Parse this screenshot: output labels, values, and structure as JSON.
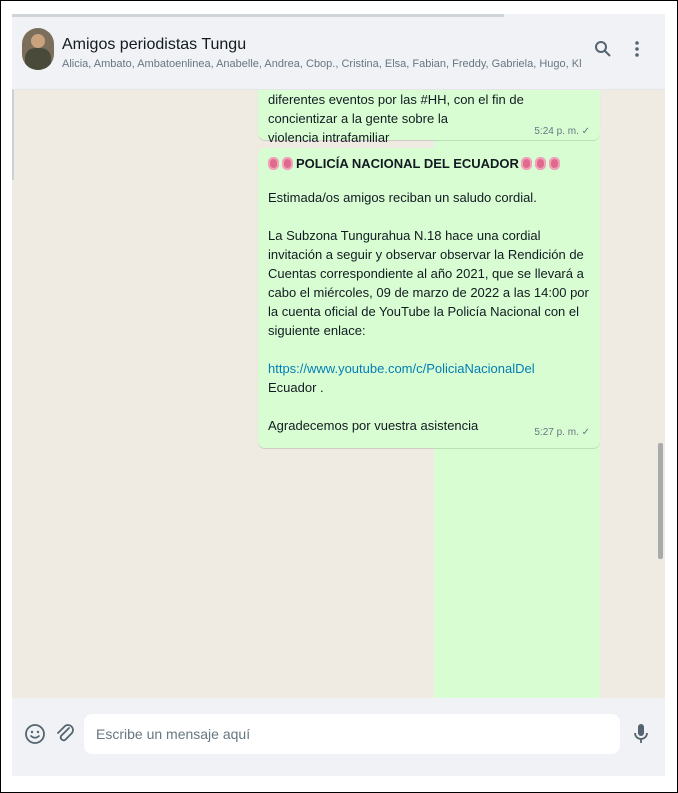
{
  "header": {
    "title": "Amigos periodistas Tungu",
    "members": "Alicia, Ambato, Ambatoenlinea, Anabelle, Andrea, Cbop., Cristina, Elsa, Fabian, Freddy, Gabriela, Hugo, Klever, Maria, Modesto, M...",
    "search_icon": "search-icon",
    "menu_icon": "more-vertical-icon"
  },
  "messages": [
    {
      "line1": "diferentes eventos por las #HH, con el fin de concientizar a la gente sobre la",
      "line2": "violencia intrafamiliar",
      "time": "5:24 p. m. ✓"
    },
    {
      "heading": "POLICÍA NACIONAL DEL ECUADOR",
      "greeting": "Estimada/os amigos reciban un saludo cordial.",
      "body": "La Subzona Tungurahua N.18 hace una cordial invitación a seguir y observar observar la Rendición de Cuentas correspondiente al año 2021, que se llevará a cabo el miércoles, 09 de marzo de 2022 a las 14:00 por la cuenta oficial de YouTube la Policía Nacional  con el siguiente enlace:",
      "link": "https://www.youtube.com/c/PoliciaNacionalDel",
      "link_tail": "Ecuador .",
      "closing": "Agradecemos por vuestra asistencia",
      "time": "5:27 p. m. ✓"
    }
  ],
  "footer": {
    "placeholder": "Escribe un mensaje aquí",
    "emoji_icon": "emoji-icon",
    "attach_icon": "paperclip-icon",
    "mic_icon": "microphone-icon"
  },
  "scroll_down_icon": "chevron-down-icon",
  "colors": {
    "bubble": "#d9fdd3",
    "background": "#efeae2",
    "link": "#027eb5"
  }
}
